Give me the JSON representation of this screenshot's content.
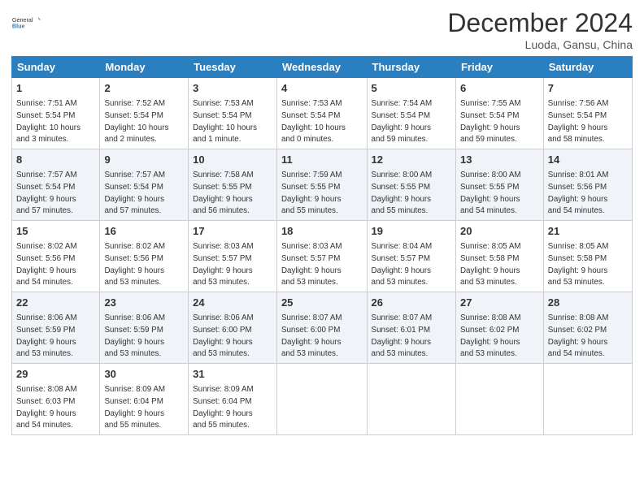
{
  "header": {
    "logo_general": "General",
    "logo_blue": "Blue",
    "month_title": "December 2024",
    "location": "Luoda, Gansu, China"
  },
  "weekdays": [
    "Sunday",
    "Monday",
    "Tuesday",
    "Wednesday",
    "Thursday",
    "Friday",
    "Saturday"
  ],
  "weeks": [
    [
      {
        "day": "1",
        "info": "Sunrise: 7:51 AM\nSunset: 5:54 PM\nDaylight: 10 hours\nand 3 minutes."
      },
      {
        "day": "2",
        "info": "Sunrise: 7:52 AM\nSunset: 5:54 PM\nDaylight: 10 hours\nand 2 minutes."
      },
      {
        "day": "3",
        "info": "Sunrise: 7:53 AM\nSunset: 5:54 PM\nDaylight: 10 hours\nand 1 minute."
      },
      {
        "day": "4",
        "info": "Sunrise: 7:53 AM\nSunset: 5:54 PM\nDaylight: 10 hours\nand 0 minutes."
      },
      {
        "day": "5",
        "info": "Sunrise: 7:54 AM\nSunset: 5:54 PM\nDaylight: 9 hours\nand 59 minutes."
      },
      {
        "day": "6",
        "info": "Sunrise: 7:55 AM\nSunset: 5:54 PM\nDaylight: 9 hours\nand 59 minutes."
      },
      {
        "day": "7",
        "info": "Sunrise: 7:56 AM\nSunset: 5:54 PM\nDaylight: 9 hours\nand 58 minutes."
      }
    ],
    [
      {
        "day": "8",
        "info": "Sunrise: 7:57 AM\nSunset: 5:54 PM\nDaylight: 9 hours\nand 57 minutes."
      },
      {
        "day": "9",
        "info": "Sunrise: 7:57 AM\nSunset: 5:54 PM\nDaylight: 9 hours\nand 57 minutes."
      },
      {
        "day": "10",
        "info": "Sunrise: 7:58 AM\nSunset: 5:55 PM\nDaylight: 9 hours\nand 56 minutes."
      },
      {
        "day": "11",
        "info": "Sunrise: 7:59 AM\nSunset: 5:55 PM\nDaylight: 9 hours\nand 55 minutes."
      },
      {
        "day": "12",
        "info": "Sunrise: 8:00 AM\nSunset: 5:55 PM\nDaylight: 9 hours\nand 55 minutes."
      },
      {
        "day": "13",
        "info": "Sunrise: 8:00 AM\nSunset: 5:55 PM\nDaylight: 9 hours\nand 54 minutes."
      },
      {
        "day": "14",
        "info": "Sunrise: 8:01 AM\nSunset: 5:56 PM\nDaylight: 9 hours\nand 54 minutes."
      }
    ],
    [
      {
        "day": "15",
        "info": "Sunrise: 8:02 AM\nSunset: 5:56 PM\nDaylight: 9 hours\nand 54 minutes."
      },
      {
        "day": "16",
        "info": "Sunrise: 8:02 AM\nSunset: 5:56 PM\nDaylight: 9 hours\nand 53 minutes."
      },
      {
        "day": "17",
        "info": "Sunrise: 8:03 AM\nSunset: 5:57 PM\nDaylight: 9 hours\nand 53 minutes."
      },
      {
        "day": "18",
        "info": "Sunrise: 8:03 AM\nSunset: 5:57 PM\nDaylight: 9 hours\nand 53 minutes."
      },
      {
        "day": "19",
        "info": "Sunrise: 8:04 AM\nSunset: 5:57 PM\nDaylight: 9 hours\nand 53 minutes."
      },
      {
        "day": "20",
        "info": "Sunrise: 8:05 AM\nSunset: 5:58 PM\nDaylight: 9 hours\nand 53 minutes."
      },
      {
        "day": "21",
        "info": "Sunrise: 8:05 AM\nSunset: 5:58 PM\nDaylight: 9 hours\nand 53 minutes."
      }
    ],
    [
      {
        "day": "22",
        "info": "Sunrise: 8:06 AM\nSunset: 5:59 PM\nDaylight: 9 hours\nand 53 minutes."
      },
      {
        "day": "23",
        "info": "Sunrise: 8:06 AM\nSunset: 5:59 PM\nDaylight: 9 hours\nand 53 minutes."
      },
      {
        "day": "24",
        "info": "Sunrise: 8:06 AM\nSunset: 6:00 PM\nDaylight: 9 hours\nand 53 minutes."
      },
      {
        "day": "25",
        "info": "Sunrise: 8:07 AM\nSunset: 6:00 PM\nDaylight: 9 hours\nand 53 minutes."
      },
      {
        "day": "26",
        "info": "Sunrise: 8:07 AM\nSunset: 6:01 PM\nDaylight: 9 hours\nand 53 minutes."
      },
      {
        "day": "27",
        "info": "Sunrise: 8:08 AM\nSunset: 6:02 PM\nDaylight: 9 hours\nand 53 minutes."
      },
      {
        "day": "28",
        "info": "Sunrise: 8:08 AM\nSunset: 6:02 PM\nDaylight: 9 hours\nand 54 minutes."
      }
    ],
    [
      {
        "day": "29",
        "info": "Sunrise: 8:08 AM\nSunset: 6:03 PM\nDaylight: 9 hours\nand 54 minutes."
      },
      {
        "day": "30",
        "info": "Sunrise: 8:09 AM\nSunset: 6:04 PM\nDaylight: 9 hours\nand 55 minutes."
      },
      {
        "day": "31",
        "info": "Sunrise: 8:09 AM\nSunset: 6:04 PM\nDaylight: 9 hours\nand 55 minutes."
      },
      null,
      null,
      null,
      null
    ]
  ]
}
